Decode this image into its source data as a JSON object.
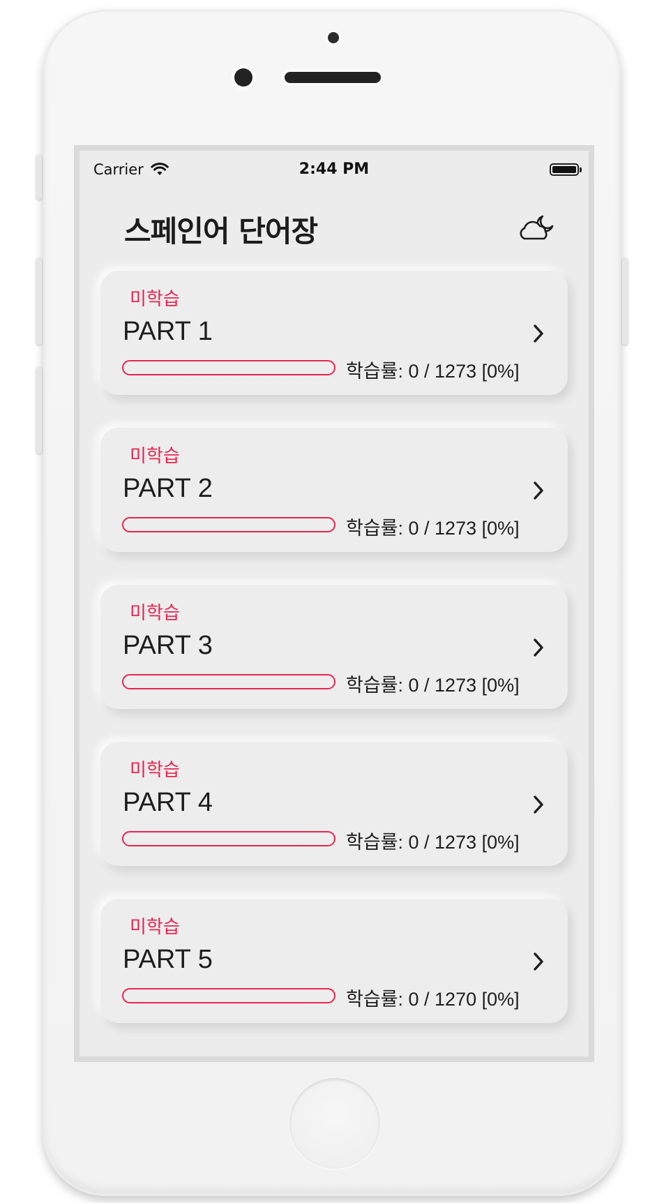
{
  "status_bar": {
    "carrier": "Carrier",
    "time": "2:44 PM",
    "wifi_icon": "wifi-icon",
    "battery_icon": "battery-icon"
  },
  "header": {
    "title": "스페인어 단어장",
    "weather_icon": "cloud-moon-icon"
  },
  "accent_color": "#e8254f",
  "parts": [
    {
      "status": "미학습",
      "title": "PART 1",
      "progress_text": "학습률: 0 / 1273 [0%]",
      "progress": 0
    },
    {
      "status": "미학습",
      "title": "PART 2",
      "progress_text": "학습률: 0 / 1273 [0%]",
      "progress": 0
    },
    {
      "status": "미학습",
      "title": "PART 3",
      "progress_text": "학습률: 0 / 1273 [0%]",
      "progress": 0
    },
    {
      "status": "미학습",
      "title": "PART 4",
      "progress_text": "학습률: 0 / 1273 [0%]",
      "progress": 0
    },
    {
      "status": "미학습",
      "title": "PART 5",
      "progress_text": "학습률: 0 / 1270 [0%]",
      "progress": 0
    }
  ]
}
